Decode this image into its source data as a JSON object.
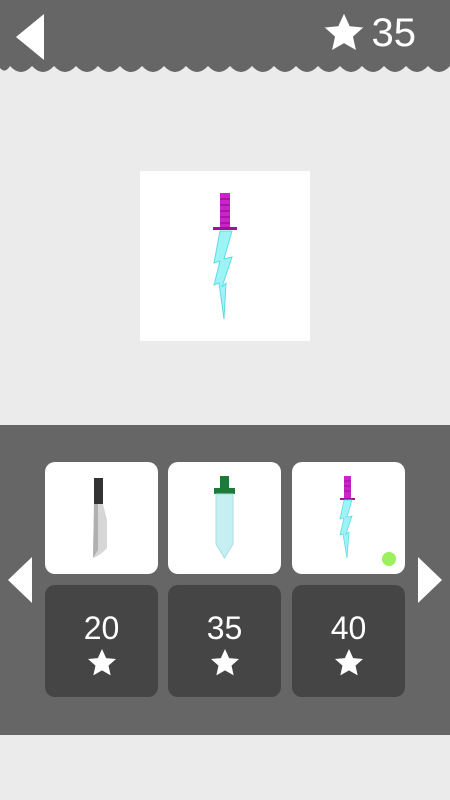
{
  "header": {
    "star_total": "35"
  },
  "preview": {
    "item": "lightning-dagger"
  },
  "shop": {
    "items": [
      {
        "name": "kitchen-knife",
        "price": "20",
        "owned": false
      },
      {
        "name": "crystal-sword",
        "price": "35",
        "owned": false
      },
      {
        "name": "lightning-dagger",
        "price": "40",
        "owned": true
      }
    ]
  },
  "colors": {
    "bar": "#666666",
    "background": "#ebebeb",
    "price_tile": "#454545",
    "lightning_blade": "#9ef3f6",
    "magenta_handle": "#cc22cc",
    "green_handle": "#1f7a3a",
    "owned_indicator": "#9cf05a"
  }
}
